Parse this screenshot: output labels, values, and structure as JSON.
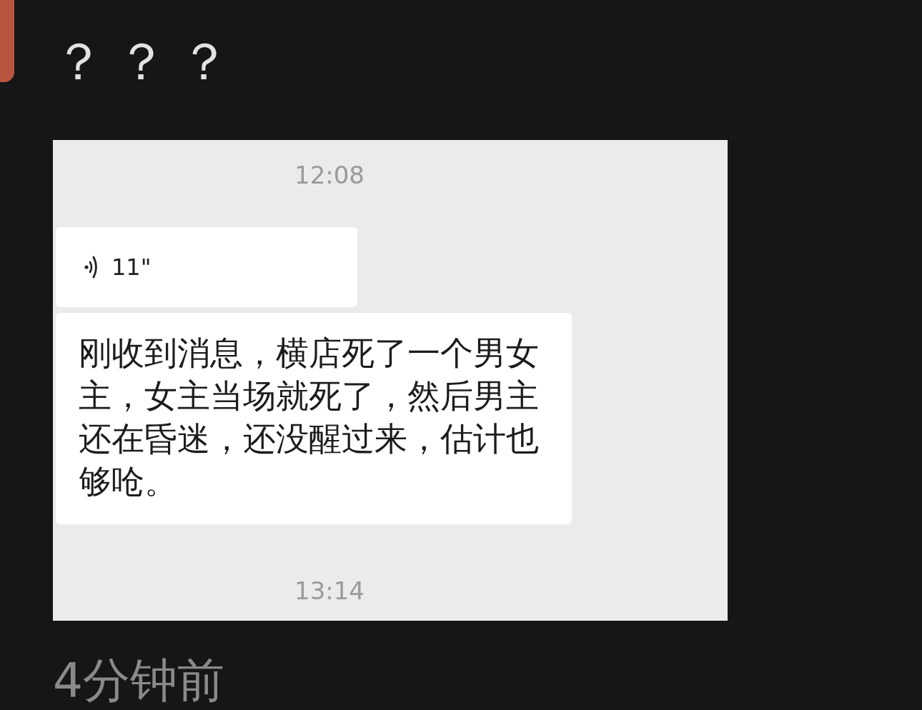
{
  "caption": "？？？",
  "screenshot": {
    "messages": [
      {
        "kind": "time",
        "text": "12:08"
      },
      {
        "kind": "voice",
        "duration": "11\""
      },
      {
        "kind": "text",
        "text": "刚收到消息，横店死了一个男女主，女主当场就死了，然后男主还在昏迷，还没醒过来，估计也够呛。"
      },
      {
        "kind": "time",
        "text": "13:14"
      }
    ]
  },
  "timestamp": "4分钟前"
}
